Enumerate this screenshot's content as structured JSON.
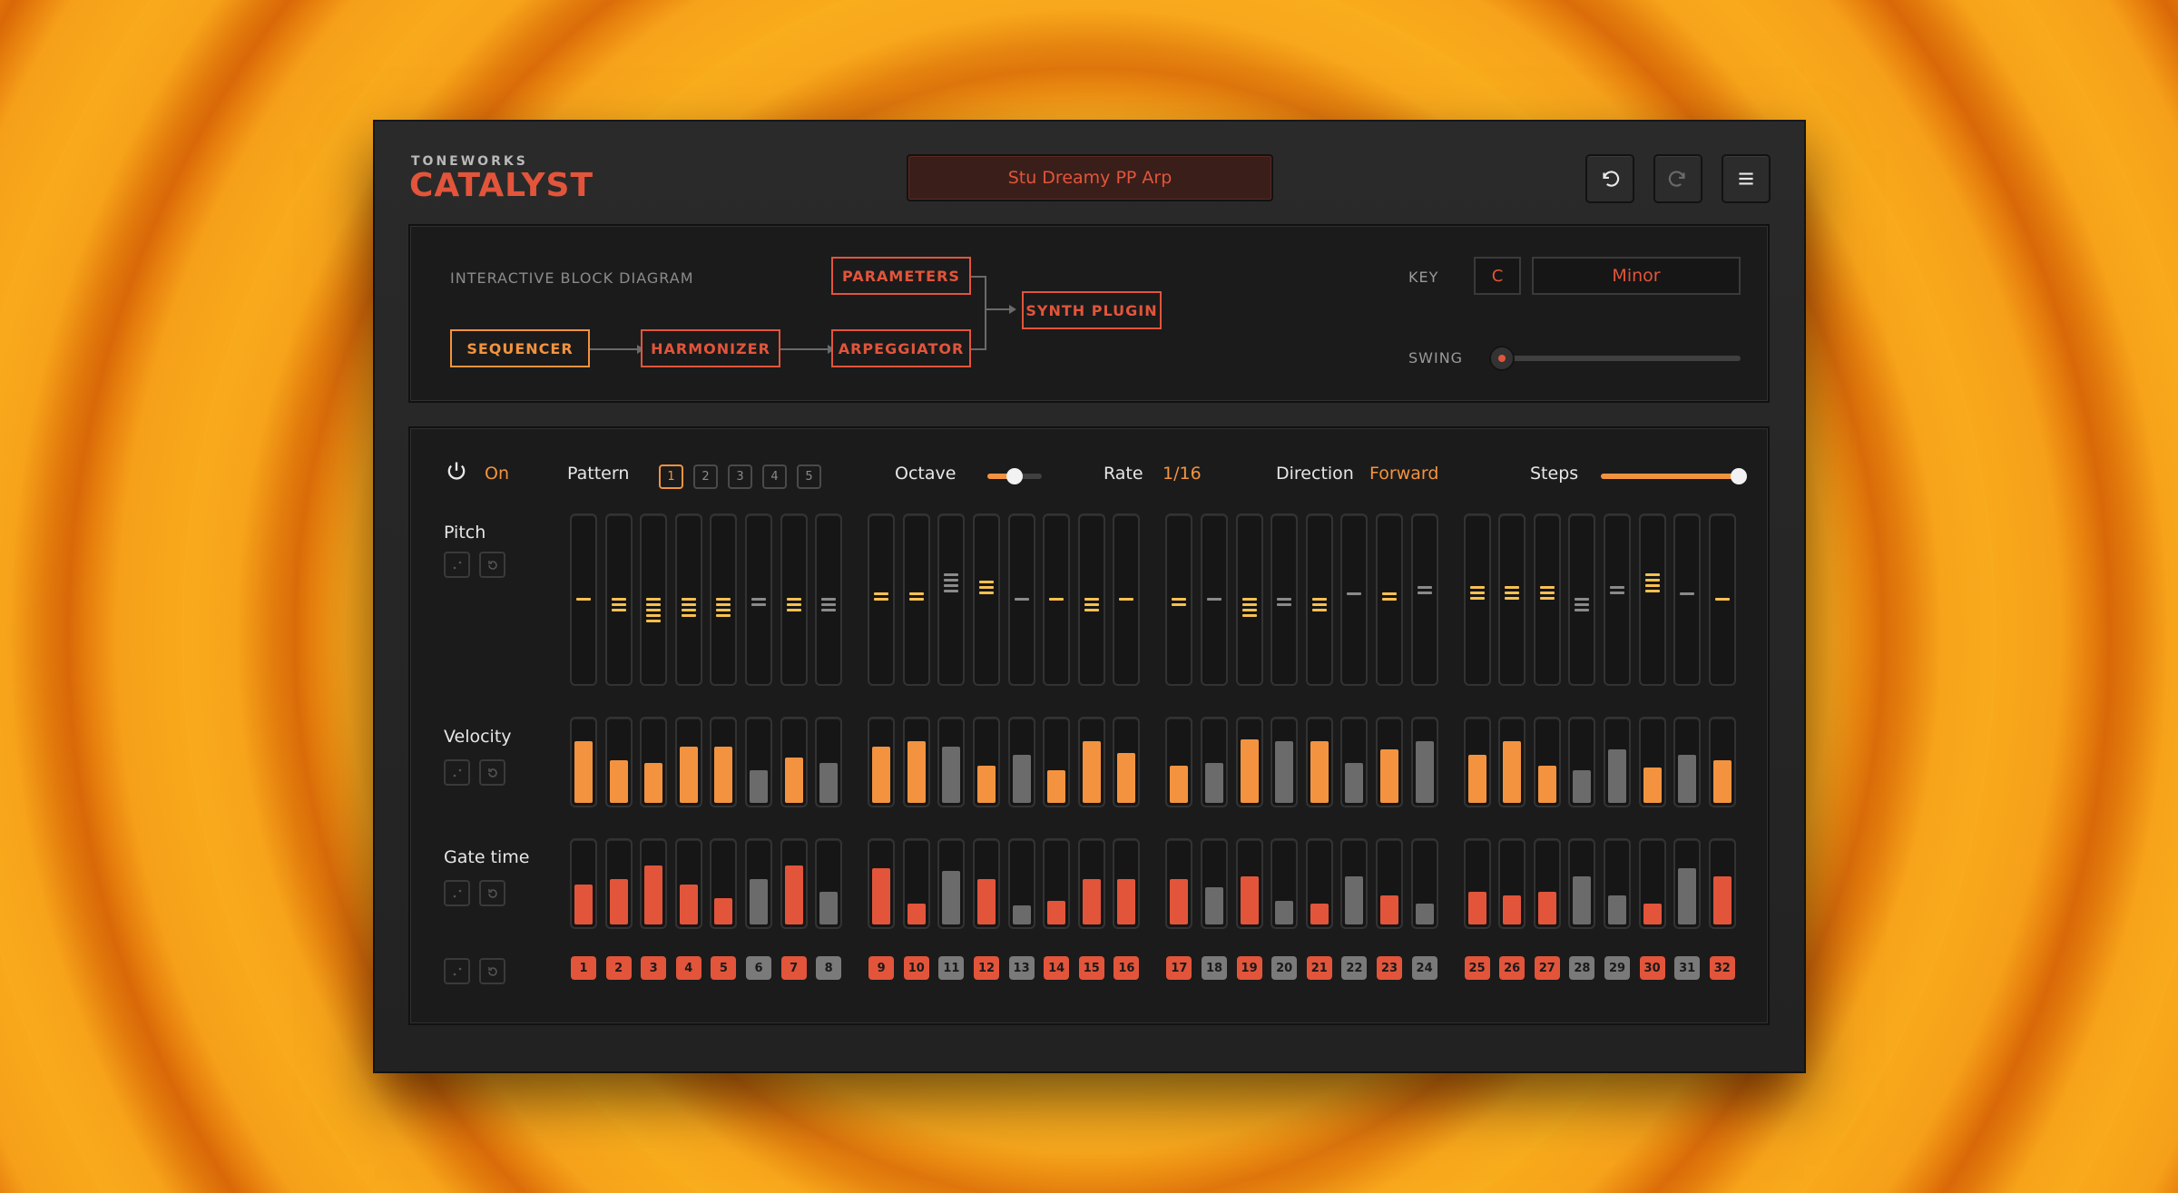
{
  "brand": {
    "maker": "TONEWORKS",
    "product": "CATALYST"
  },
  "preset": {
    "name": "Stu Dreamy PP Arp"
  },
  "header": {
    "undo_icon": "undo-icon",
    "redo_icon": "redo-icon",
    "menu_icon": "menu-icon"
  },
  "diagram": {
    "title": "INTERACTIVE BLOCK DIAGRAM",
    "blocks": {
      "sequencer": "SEQUENCER",
      "harmonizer": "HARMONIZER",
      "arpeggiator": "ARPEGGIATOR",
      "parameters": "PARAMETERS",
      "synth": "SYNTH PLUGIN"
    },
    "key_label": "KEY",
    "key_value": "C",
    "scale_value": "Minor",
    "swing_label": "SWING",
    "swing_value": 0
  },
  "sequencer": {
    "power_label": "On",
    "pattern_label": "Pattern",
    "patterns": [
      "1",
      "2",
      "3",
      "4",
      "5"
    ],
    "selected_pattern": "1",
    "octave_label": "Octave",
    "octave_level": 0.5,
    "rate_label": "Rate",
    "rate_value": "1/16",
    "direction_label": "Direction",
    "direction_value": "Forward",
    "steps_label": "Steps",
    "steps_level": 1.0,
    "pitch_label": "Pitch",
    "velocity_label": "Velocity",
    "gate_label": "Gate time",
    "active": [
      1,
      1,
      1,
      1,
      1,
      0,
      1,
      0,
      1,
      1,
      0,
      1,
      0,
      1,
      1,
      1,
      1,
      0,
      1,
      0,
      1,
      0,
      1,
      0,
      1,
      1,
      1,
      0,
      0,
      1,
      0,
      1
    ],
    "step_numbers": [
      "1",
      "2",
      "3",
      "4",
      "5",
      "6",
      "7",
      "8",
      "9",
      "10",
      "11",
      "12",
      "13",
      "14",
      "15",
      "16",
      "17",
      "18",
      "19",
      "20",
      "21",
      "22",
      "23",
      "24",
      "25",
      "26",
      "27",
      "28",
      "29",
      "30",
      "31",
      "32"
    ],
    "pitch": [
      {
        "top": 0.5,
        "n": 1
      },
      {
        "top": 0.5,
        "n": 3
      },
      {
        "top": 0.5,
        "n": 5
      },
      {
        "top": 0.5,
        "n": 4
      },
      {
        "top": 0.5,
        "n": 4
      },
      {
        "top": 0.5,
        "n": 2
      },
      {
        "top": 0.5,
        "n": 3
      },
      {
        "top": 0.5,
        "n": 3
      },
      {
        "top": 0.47,
        "n": 2
      },
      {
        "top": 0.47,
        "n": 2
      },
      {
        "top": 0.36,
        "n": 4
      },
      {
        "top": 0.4,
        "n": 3
      },
      {
        "top": 0.5,
        "n": 1
      },
      {
        "top": 0.5,
        "n": 1
      },
      {
        "top": 0.5,
        "n": 3
      },
      {
        "top": 0.5,
        "n": 1
      },
      {
        "top": 0.5,
        "n": 2
      },
      {
        "top": 0.5,
        "n": 1
      },
      {
        "top": 0.5,
        "n": 4
      },
      {
        "top": 0.5,
        "n": 2
      },
      {
        "top": 0.5,
        "n": 3
      },
      {
        "top": 0.47,
        "n": 1
      },
      {
        "top": 0.47,
        "n": 2
      },
      {
        "top": 0.43,
        "n": 2
      },
      {
        "top": 0.43,
        "n": 3
      },
      {
        "top": 0.43,
        "n": 3
      },
      {
        "top": 0.43,
        "n": 3
      },
      {
        "top": 0.5,
        "n": 3
      },
      {
        "top": 0.43,
        "n": 2
      },
      {
        "top": 0.36,
        "n": 4
      },
      {
        "top": 0.47,
        "n": 1
      },
      {
        "top": 0.5,
        "n": 1
      }
    ],
    "velocity": [
      0.72,
      0.5,
      0.47,
      0.66,
      0.66,
      0.38,
      0.53,
      0.47,
      0.66,
      0.72,
      0.66,
      0.44,
      0.56,
      0.38,
      0.72,
      0.59,
      0.44,
      0.47,
      0.75,
      0.72,
      0.72,
      0.47,
      0.63,
      0.72,
      0.56,
      0.72,
      0.44,
      0.38,
      0.63,
      0.41,
      0.56,
      0.5
    ],
    "gate": [
      0.47,
      0.53,
      0.69,
      0.47,
      0.31,
      0.53,
      0.69,
      0.38,
      0.66,
      0.25,
      0.63,
      0.53,
      0.22,
      0.28,
      0.53,
      0.53,
      0.53,
      0.44,
      0.56,
      0.28,
      0.25,
      0.56,
      0.34,
      0.25,
      0.38,
      0.34,
      0.38,
      0.56,
      0.34,
      0.25,
      0.66,
      0.56
    ]
  },
  "colors": {
    "accent": "#f3933f",
    "brand_red": "#e2553b",
    "pitch_active": "#f8c050",
    "inactive": "#6b6b6b"
  }
}
